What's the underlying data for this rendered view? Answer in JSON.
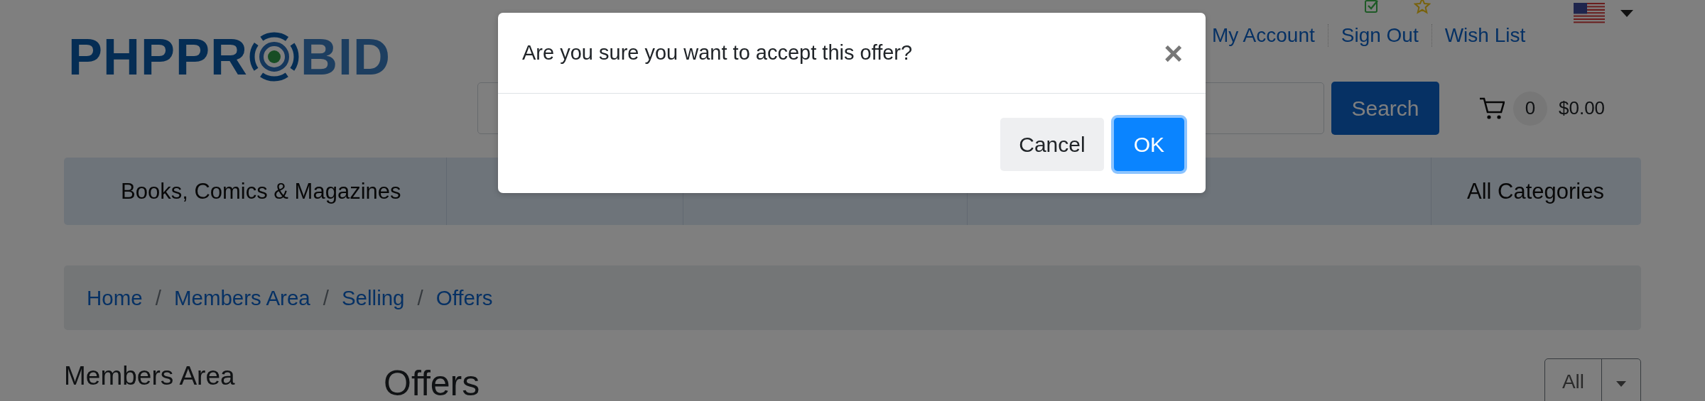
{
  "logo": {
    "left": "PHPPR",
    "right": "BID"
  },
  "account_links": [
    "My Account",
    "Sign Out",
    "Wish List"
  ],
  "search": {
    "button": "Search"
  },
  "cart": {
    "count": "0",
    "total": "$0.00"
  },
  "categories": [
    "Books, Comics & Magazines",
    "All Categories"
  ],
  "breadcrumb": {
    "separator": "/",
    "items": [
      "Home",
      "Members Area",
      "Selling",
      "Offers"
    ]
  },
  "sidebar": {
    "title": "Members Area"
  },
  "page": {
    "title": "Offers",
    "filter": "All"
  },
  "modal": {
    "message": "Are you sure you want to accept this offer?",
    "close": "×",
    "buttons": [
      {
        "label": "Cancel",
        "kind": "secondary"
      },
      {
        "label": "OK",
        "kind": "primary"
      }
    ]
  }
}
